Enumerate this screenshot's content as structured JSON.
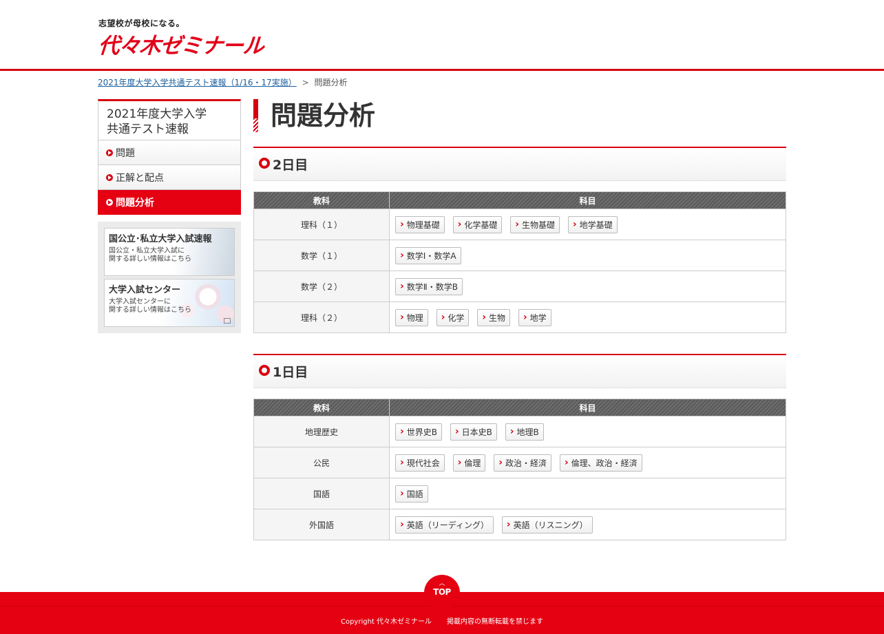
{
  "header": {
    "tagline": "志望校が母校になる。",
    "logo": "代々木ゼミナール"
  },
  "breadcrumb": {
    "link": "2021年度大学入学共通テスト速報（1/16・17実施）",
    "separator": ">",
    "current": "問題分析"
  },
  "sidebar": {
    "title_line1": "2021年度大学入学",
    "title_line2": "共通テスト速報",
    "items": [
      {
        "label": "問題"
      },
      {
        "label": "正解と配点"
      },
      {
        "label": "問題分析"
      }
    ],
    "banners": [
      {
        "title": "国公立･私立大学入試速報",
        "sub1": "国公立・私立大学入試に",
        "sub2": "関する詳しい情報はこちら"
      },
      {
        "title": "大学入試センター",
        "sub1": "大学入試センターに",
        "sub2": "関する詳しい情報はこちら"
      }
    ]
  },
  "main": {
    "title": "問題分析",
    "sections": [
      {
        "heading": "2日目",
        "col1": "教科",
        "col2": "科目",
        "rows": [
          {
            "subject": "理科（１）",
            "items": [
              "物理基礎",
              "化学基礎",
              "生物基礎",
              "地学基礎"
            ]
          },
          {
            "subject": "数学（１）",
            "items": [
              "数学Ⅰ・数学A"
            ]
          },
          {
            "subject": "数学（２）",
            "items": [
              "数学Ⅱ・数学B"
            ]
          },
          {
            "subject": "理科（２）",
            "items": [
              "物理",
              "化学",
              "生物",
              "地学"
            ]
          }
        ]
      },
      {
        "heading": "1日目",
        "col1": "教科",
        "col2": "科目",
        "rows": [
          {
            "subject": "地理歴史",
            "items": [
              "世界史B",
              "日本史B",
              "地理B"
            ]
          },
          {
            "subject": "公民",
            "items": [
              "現代社会",
              "倫理",
              "政治・経済",
              "倫理、政治・経済"
            ]
          },
          {
            "subject": "国語",
            "items": [
              "国語"
            ]
          },
          {
            "subject": "外国語",
            "items": [
              "英語（リーディング）",
              "英語（リスニング）"
            ]
          }
        ]
      }
    ]
  },
  "footer": {
    "top_arrow": "︿",
    "top_label": "TOP",
    "copyright": "Copyright 代々木ゼミナール",
    "notice": "掲載内容の無断転載を禁じます"
  },
  "colors": {
    "accent": "#e50012",
    "table_header": "#5a5a5a"
  }
}
